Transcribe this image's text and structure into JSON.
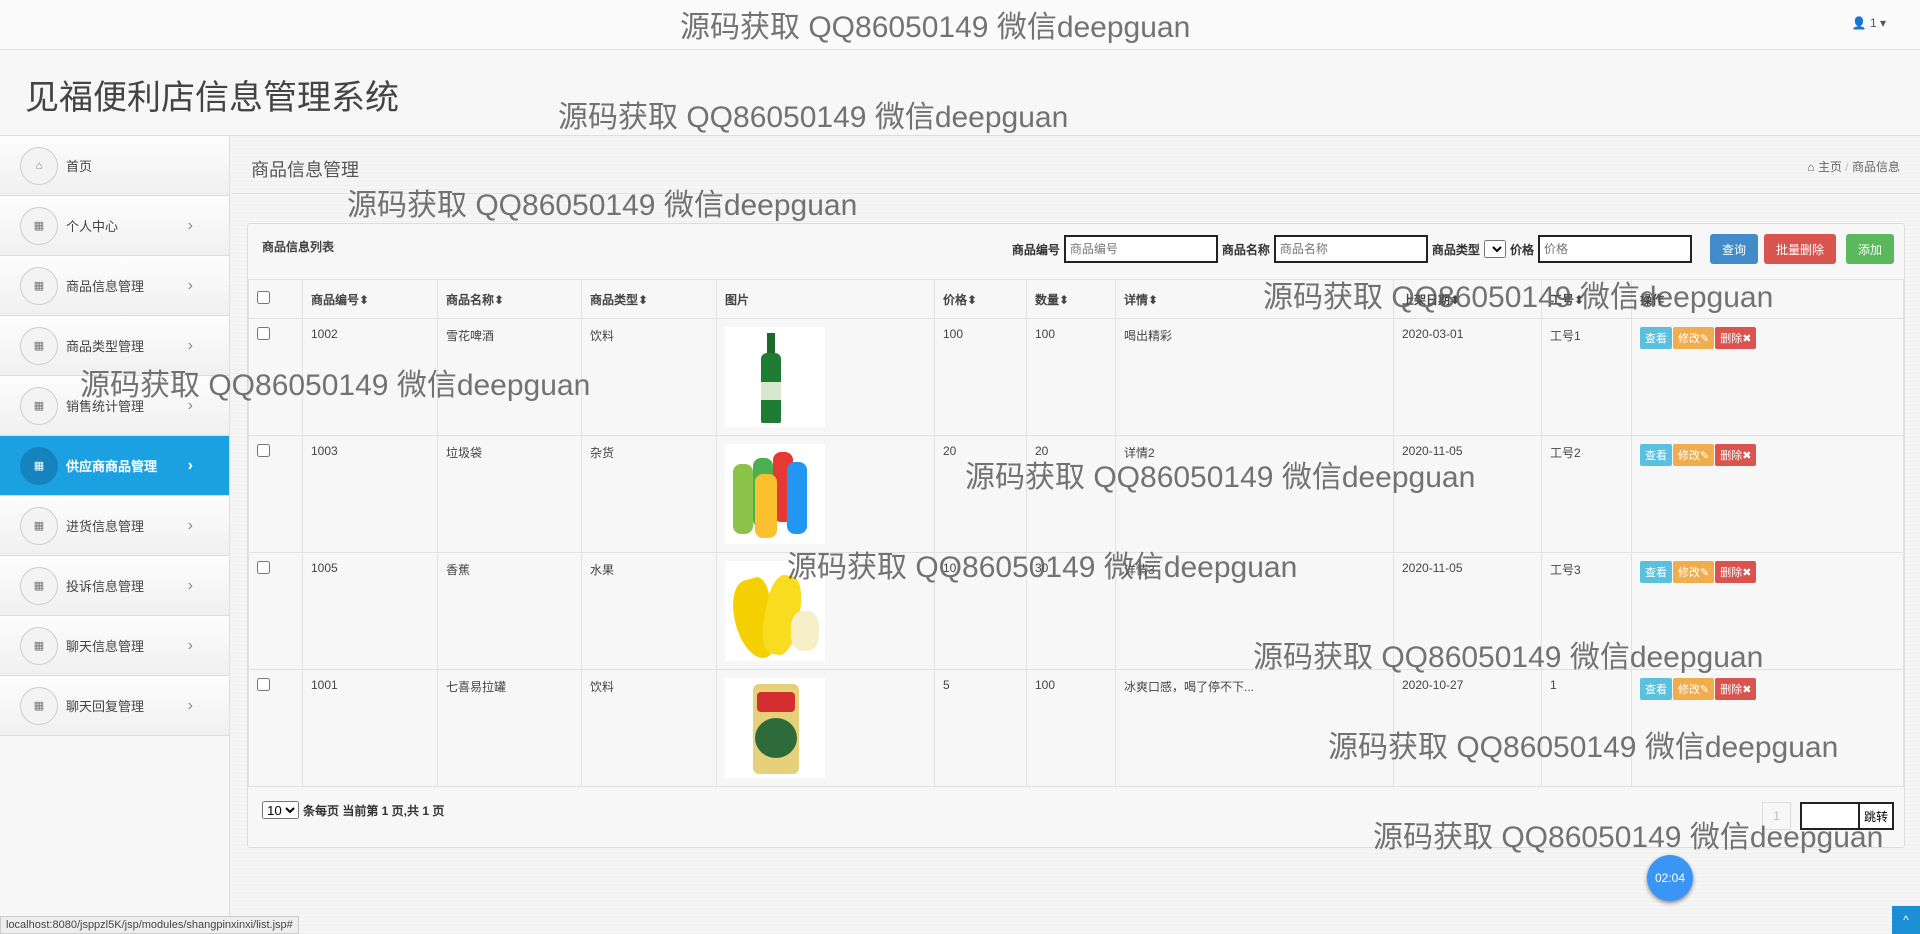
{
  "topbar": {
    "user": "1"
  },
  "header": {
    "title": "见福便利店信息管理系统"
  },
  "sidebar": {
    "items": [
      {
        "label": "首页",
        "icon": "home-icon",
        "chev": false
      },
      {
        "label": "个人中心",
        "icon": "grid-icon",
        "chev": true
      },
      {
        "label": "商品信息管理",
        "icon": "grid-icon",
        "chev": true
      },
      {
        "label": "商品类型管理",
        "icon": "grid-icon",
        "chev": true
      },
      {
        "label": "销售统计管理",
        "icon": "grid-icon",
        "chev": true
      },
      {
        "label": "供应商商品管理",
        "icon": "grid-icon",
        "chev": true,
        "active": true
      },
      {
        "label": "进货信息管理",
        "icon": "grid-icon",
        "chev": true
      },
      {
        "label": "投诉信息管理",
        "icon": "grid-icon",
        "chev": true
      },
      {
        "label": "聊天信息管理",
        "icon": "grid-icon",
        "chev": true
      },
      {
        "label": "聊天回复管理",
        "icon": "grid-icon",
        "chev": true
      }
    ]
  },
  "page": {
    "title": "商品信息管理",
    "breadcrumb_home": "主页",
    "breadcrumb_sep": "/",
    "breadcrumb_current": "商品信息"
  },
  "panel": {
    "title": "商品信息列表",
    "search": {
      "code_label": "商品编号",
      "code_placeholder": "商品编号",
      "name_label": "商品名称",
      "name_placeholder": "商品名称",
      "type_label": "商品类型",
      "price_label": "价格",
      "price_placeholder": "价格",
      "query": "查询",
      "batch_delete": "批量删除",
      "add": "添加"
    },
    "columns": [
      "商品编号",
      "商品名称",
      "商品类型",
      "图片",
      "价格",
      "数量",
      "详情",
      "上架日期",
      "工号",
      "操作"
    ],
    "rows": [
      {
        "code": "1002",
        "name": "雪花啤酒",
        "type": "饮料",
        "image": "beer-bottle",
        "price": "100",
        "qty": "100",
        "detail": "喝出精彩",
        "date": "2020-03-01",
        "staff": "工号1"
      },
      {
        "code": "1003",
        "name": "垃圾袋",
        "type": "杂货",
        "image": "trash-bags",
        "price": "20",
        "qty": "20",
        "detail": "详情2",
        "date": "2020-11-05",
        "staff": "工号2"
      },
      {
        "code": "1005",
        "name": "香蕉",
        "type": "水果",
        "image": "bananas",
        "price": "10",
        "qty": "30",
        "detail": "详情3",
        "date": "2020-11-05",
        "staff": "工号3"
      },
      {
        "code": "1001",
        "name": "七喜易拉罐",
        "type": "饮料",
        "image": "soda-can",
        "price": "5",
        "qty": "100",
        "detail": "冰爽口感，喝了停不下...",
        "date": "2020-10-27",
        "staff": "1"
      }
    ],
    "actions": {
      "view": "查看",
      "edit": "修改",
      "delete": "删除"
    },
    "footer": {
      "page_size": "10",
      "info": "条每页 当前第 1 页,共 1 页",
      "page": "1",
      "jump": "跳转"
    }
  },
  "watermark": "源码获取 QQ86050149 微信deepguan",
  "timer": "02:04",
  "status_url": "localhost:8080/jsppzl5K/jsp/modules/shangpinxinxi/list.jsp#",
  "colors": {
    "accent": "#1ba1e2",
    "info": "#5bc0de",
    "warning": "#f0ad4e",
    "danger": "#d9534f",
    "primary": "#428bca",
    "success": "#5cb85c"
  }
}
